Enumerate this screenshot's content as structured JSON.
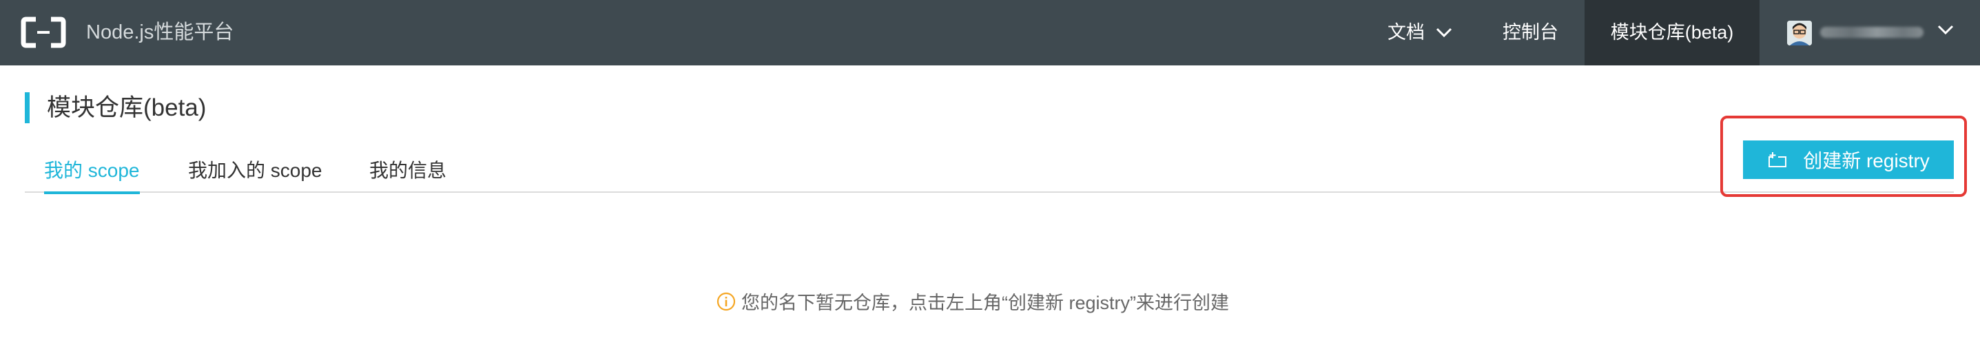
{
  "brand": {
    "name": "Node.js性能平台"
  },
  "nav": {
    "docs_label": "文档",
    "console_label": "控制台",
    "modules_label": "模块仓库(beta)"
  },
  "page": {
    "title": "模块仓库(beta)",
    "tabs": [
      {
        "label": "我的 scope",
        "active": true
      },
      {
        "label": "我加入的 scope",
        "active": false
      },
      {
        "label": "我的信息",
        "active": false
      }
    ],
    "create_button_label": "创建新 registry",
    "empty_message": "您的名下暂无仓库，点击左上角“创建新 registry”来进行创建"
  },
  "colors": {
    "topbar": "#3f4a50",
    "accent": "#1fb6d9",
    "highlight": "#e53935",
    "warning": "#f5a623"
  },
  "icons": {
    "logo": "cloud-bracket-logo",
    "docs_dropdown": "chevron-down-icon",
    "user_dropdown": "chevron-down-icon",
    "create": "add-folder-icon",
    "info": "info-circle-icon"
  }
}
